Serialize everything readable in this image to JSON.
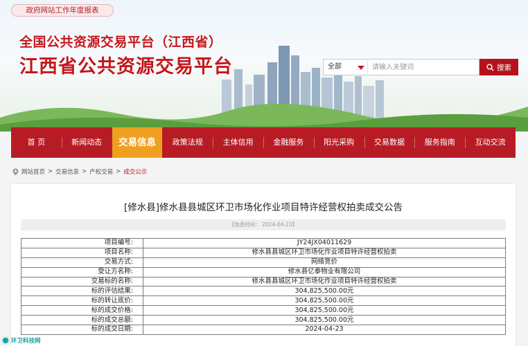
{
  "header": {
    "report_link": "政府网站工作年度报表",
    "sub_title": "全国公共资源交易平台（江西省）",
    "main_title": "江西省公共资源交易平台"
  },
  "search": {
    "selected": "全部",
    "placeholder": "请输入关键词",
    "button_label": "搜索"
  },
  "nav": {
    "items": [
      "首 页",
      "新闻动态",
      "交易信息",
      "政策法规",
      "主体信用",
      "金融服务",
      "阳光采购",
      "交易数据",
      "服务指南",
      "互动交流"
    ],
    "active": "交易信息"
  },
  "breadcrumb": {
    "items": [
      "网站首页",
      "交易信息",
      "产权交易"
    ],
    "current": "成交公示",
    "separator": ">"
  },
  "article": {
    "title": "[修水县]修水县县城区环卫市场化作业项目特许经营权拍卖成交公告",
    "info": "【信息时间：  2024-04-23】"
  },
  "table": {
    "rows": [
      {
        "label": "项目编号:",
        "value": "JY24JX04011629"
      },
      {
        "label": "项目名称:",
        "value": "修水县县城区环卫市场化作业项目特许经营权拍卖"
      },
      {
        "label": "交易方式:",
        "value": "网络竞价"
      },
      {
        "label": "受让方名称:",
        "value": "修水县亿泰物业有限公司"
      },
      {
        "label": "交易标的名称:",
        "value": "修水县县城区环卫市场化作业项目特许经营权拍卖"
      },
      {
        "label": "标的评估结果:",
        "value": "304,825,500.00元"
      },
      {
        "label": "标的转让底价:",
        "value": "304,825,500.00元"
      },
      {
        "label": "标的成交价格:",
        "value": "304,825,500.00元"
      },
      {
        "label": "标的成交总额:",
        "value": "304,825,500.00元"
      },
      {
        "label": "标的成交日期:",
        "value": "2024-04-23"
      }
    ]
  },
  "watermark": {
    "text": "环卫科技网"
  },
  "colors": {
    "brand_red": "#b71c25",
    "active_orange": "#f0a020",
    "title_red": "#c4161c"
  }
}
